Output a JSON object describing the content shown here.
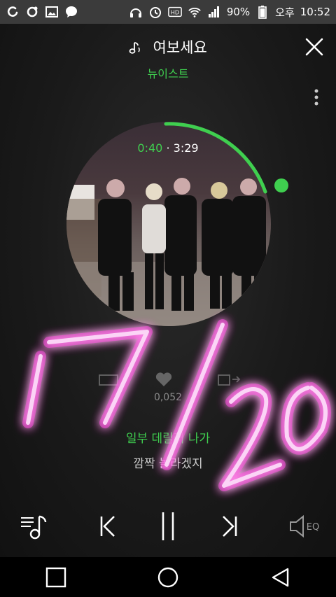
{
  "status_bar": {
    "battery": "90%",
    "ampm": "오후",
    "time": "10:52",
    "icons_left": [
      "talk-icon",
      "refresh-icon",
      "gallery-icon",
      "chat-icon"
    ],
    "icons_right": [
      "headphone-icon",
      "alarm-icon",
      "hd-icon",
      "wifi-icon",
      "signal-icon",
      "battery-icon"
    ]
  },
  "song": {
    "title": "여보세요",
    "artist": "뉴이스트",
    "current_time": "0:40",
    "separator": "·",
    "total_time": "3:29",
    "progress": 0.191,
    "like_count": "0,052"
  },
  "lyrics": {
    "current": "일부 데릴러 나가",
    "next": "깜짝 놀라겠지"
  },
  "overlay": {
    "handwriting": "7/20",
    "color": "#ff40e0"
  },
  "colors": {
    "accent": "#3fcf4f",
    "background": "#1a1a1a",
    "status_bar": "#3b3b3b"
  }
}
